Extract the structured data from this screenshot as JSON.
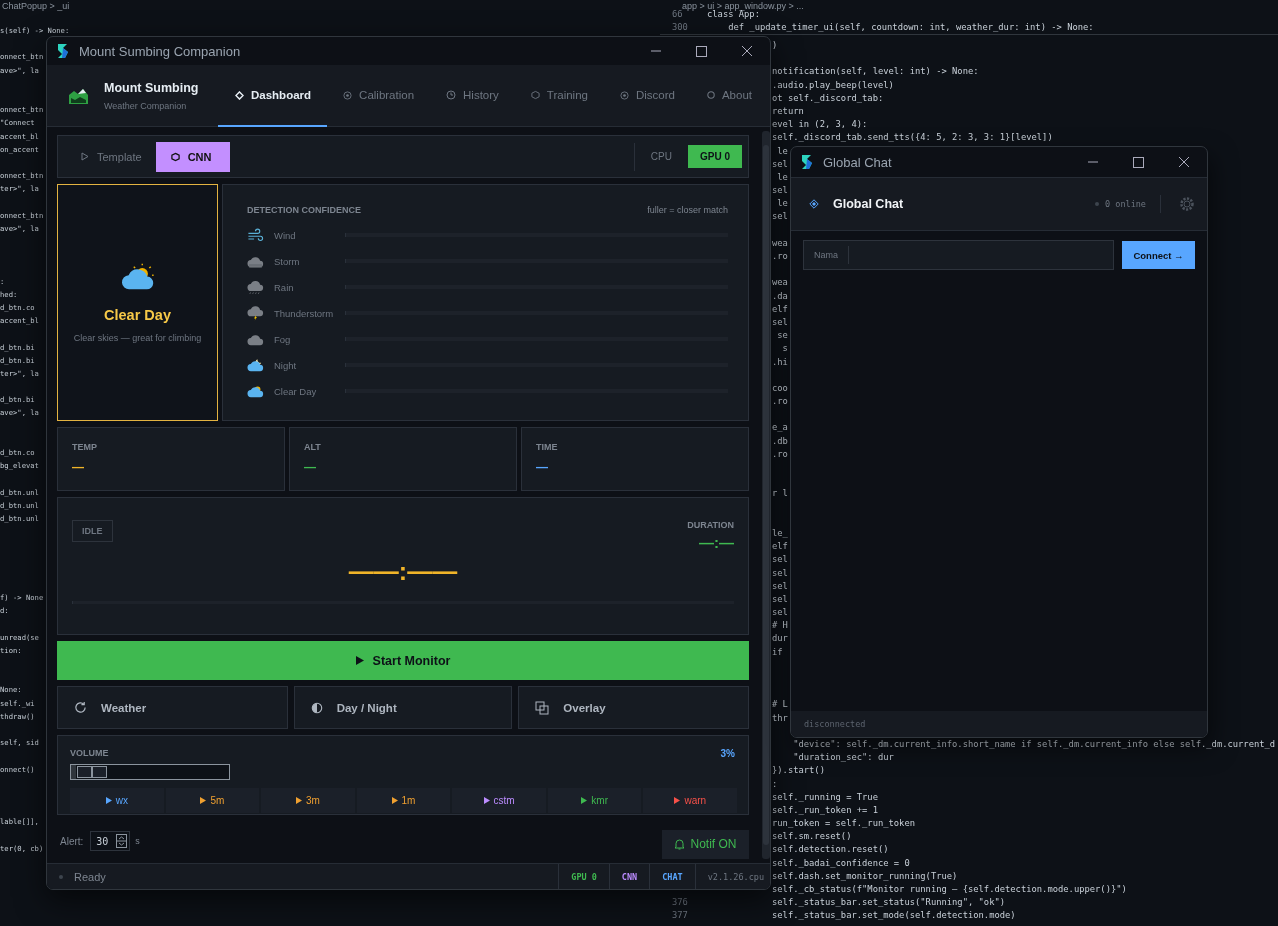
{
  "editor": {
    "left_breadcrumb": "ChatPopup > _ui",
    "left_lines": [
      {
        "kind": "code",
        "text": "s(self) -> None:"
      },
      {
        "kind": "blank"
      },
      {
        "kind": "code",
        "text": "onnect_btn"
      },
      {
        "kind": "code",
        "text": "ave>\", la"
      },
      {
        "kind": "blank"
      },
      {
        "kind": "blank"
      },
      {
        "kind": "code",
        "text": "onnect_btn"
      },
      {
        "kind": "code",
        "text": "\"Connect"
      },
      {
        "kind": "code",
        "text": "accent_bl"
      },
      {
        "kind": "code",
        "text": "on_accent"
      },
      {
        "kind": "blank"
      },
      {
        "kind": "code",
        "text": "onnect_btn"
      },
      {
        "kind": "code",
        "text": "ter>\", la"
      },
      {
        "kind": "blank"
      },
      {
        "kind": "code",
        "text": "onnect_btn"
      },
      {
        "kind": "code",
        "text": "ave>\", la"
      },
      {
        "kind": "blank"
      },
      {
        "kind": "blank"
      },
      {
        "kind": "blank"
      },
      {
        "kind": "code",
        "text": ":"
      },
      {
        "kind": "code",
        "text": "hed:"
      },
      {
        "kind": "code",
        "text": "d_btn.co"
      },
      {
        "kind": "code",
        "text": "accent_bl"
      },
      {
        "kind": "blank"
      },
      {
        "kind": "code",
        "text": "d_btn.bi"
      },
      {
        "kind": "code",
        "text": "d_btn.bi"
      },
      {
        "kind": "code",
        "text": "ter>\", la"
      },
      {
        "kind": "blank"
      },
      {
        "kind": "code",
        "text": "d_btn.bi"
      },
      {
        "kind": "code",
        "text": "ave>\", la"
      },
      {
        "kind": "blank"
      },
      {
        "kind": "blank"
      },
      {
        "kind": "code",
        "text": "d_btn.co"
      },
      {
        "kind": "code",
        "text": "bg_elevat"
      },
      {
        "kind": "blank"
      },
      {
        "kind": "code",
        "text": "d_btn.unl"
      },
      {
        "kind": "code",
        "text": "d_btn.unl"
      },
      {
        "kind": "code",
        "text": "d_btn.unl"
      },
      {
        "kind": "blank"
      },
      {
        "kind": "blank"
      },
      {
        "kind": "blank"
      },
      {
        "kind": "blank"
      },
      {
        "kind": "blank"
      },
      {
        "kind": "code",
        "text": "f) -> None"
      },
      {
        "kind": "code",
        "text": "d:"
      },
      {
        "kind": "blank"
      },
      {
        "kind": "code",
        "text": "unread(se"
      },
      {
        "kind": "code",
        "text": "tion:"
      },
      {
        "kind": "blank"
      },
      {
        "kind": "blank"
      },
      {
        "kind": "code",
        "text": "None:"
      },
      {
        "kind": "code",
        "text": "self._wi"
      },
      {
        "kind": "code",
        "text": "thdraw()"
      },
      {
        "kind": "blank"
      },
      {
        "kind": "code",
        "text": "self, sid"
      },
      {
        "kind": "blank"
      },
      {
        "kind": "code",
        "text": "onnect()"
      },
      {
        "kind": "blank"
      },
      {
        "kind": "blank"
      },
      {
        "kind": "blank"
      },
      {
        "kind": "code",
        "text": "lable[]],"
      },
      {
        "kind": "blank"
      },
      {
        "kind": "code",
        "text": "ter(0, cb)"
      }
    ],
    "right_breadcrumb": "app > ui > app_window.py > ...",
    "sticky": [
      {
        "number": "66",
        "text": "class App:"
      },
      {
        "number": "300",
        "text": "    def _update_timer_ui(self, countdown: int, weather_dur: int) -> None:"
      }
    ],
    "right_lines": [
      {
        "kind": "code",
        "text": ")"
      },
      {
        "kind": "blank"
      },
      {
        "kind": "code",
        "text": "notification(self, level: int) -> None:"
      },
      {
        "kind": "code",
        "text": ".audio.play_beep(level)"
      },
      {
        "kind": "code",
        "text": "ot self._discord_tab:"
      },
      {
        "kind": "code",
        "text": "return"
      },
      {
        "kind": "code",
        "text": "evel in (2, 3, 4):"
      },
      {
        "kind": "code",
        "text": "self._discord_tab.send_tts({4: 5, 2: 3, 3: 1}[level])"
      },
      {
        "kind": "code",
        "text": " le"
      },
      {
        "kind": "code",
        "text": "sel"
      },
      {
        "kind": "code",
        "text": " le"
      },
      {
        "kind": "code",
        "text": "sel"
      },
      {
        "kind": "code",
        "text": " le"
      },
      {
        "kind": "code",
        "text": "sel"
      },
      {
        "kind": "blank"
      },
      {
        "kind": "code",
        "text": "wea"
      },
      {
        "kind": "code",
        "text": ".ro"
      },
      {
        "kind": "blank"
      },
      {
        "kind": "code",
        "text": "wea"
      },
      {
        "kind": "code",
        "text": ".da"
      },
      {
        "kind": "code",
        "text": "elf"
      },
      {
        "kind": "code",
        "text": "sel"
      },
      {
        "kind": "code",
        "text": " se"
      },
      {
        "kind": "code",
        "text": "  s"
      },
      {
        "kind": "code",
        "text": ".hi"
      },
      {
        "kind": "blank"
      },
      {
        "kind": "code",
        "text": "coo"
      },
      {
        "kind": "code",
        "text": ".ro"
      },
      {
        "kind": "blank"
      },
      {
        "kind": "code",
        "text": "e_a"
      },
      {
        "kind": "code",
        "text": ".db"
      },
      {
        "kind": "code",
        "text": ".ro"
      },
      {
        "kind": "blank"
      },
      {
        "kind": "blank"
      },
      {
        "kind": "code",
        "text": "r l"
      },
      {
        "kind": "blank"
      },
      {
        "kind": "blank"
      },
      {
        "kind": "code",
        "text": "le_"
      },
      {
        "kind": "code",
        "text": "elf"
      },
      {
        "kind": "code",
        "text": "sel"
      },
      {
        "kind": "code",
        "text": "sel"
      },
      {
        "kind": "code",
        "text": "sel"
      },
      {
        "kind": "code",
        "text": "sel"
      },
      {
        "kind": "code",
        "text": "sel"
      },
      {
        "kind": "code",
        "text": "# H"
      },
      {
        "kind": "code",
        "text": "dur"
      },
      {
        "kind": "code",
        "text": "if"
      },
      {
        "kind": "blank"
      },
      {
        "kind": "blank"
      },
      {
        "kind": "blank"
      },
      {
        "kind": "code",
        "text": "# L"
      },
      {
        "kind": "code",
        "text": "thr"
      },
      {
        "kind": "blank"
      },
      {
        "kind": "code",
        "text": "    \"device\": self._dm.current_info.short_name if self._dm.current_info else self._dm.current_d"
      },
      {
        "kind": "code",
        "text": "    \"duration_sec\": dur"
      },
      {
        "kind": "code",
        "text": "}).start()"
      },
      {
        "kind": "code",
        "text": ":"
      },
      {
        "kind": "code",
        "text": "self._running = True"
      },
      {
        "kind": "code",
        "text": "self._run_token += 1"
      },
      {
        "kind": "code",
        "text": "run_token = self._run_token"
      },
      {
        "kind": "code",
        "text": "self.sm.reset()"
      },
      {
        "kind": "code",
        "text": "self.detection.reset()"
      },
      {
        "kind": "code",
        "text": "self._badai_confidence = 0"
      },
      {
        "kind": "code",
        "text": "self.dash.set_monitor_running(True)"
      },
      {
        "kind": "code",
        "text": "self._cb_status(f\"Monitor running — {self.detection.mode.upper()}\")"
      },
      {
        "kind": "code",
        "number": "376",
        "text": "self._status_bar.set_status(\"Running\", \"ok\")"
      },
      {
        "kind": "code",
        "number": "377",
        "text": "self._status_bar.set_mode(self.detection.mode)"
      }
    ]
  },
  "main_window": {
    "title": "Mount Sumbing Companion",
    "brand": {
      "name": "Mount Sumbing",
      "subtitle": "Weather Companion"
    },
    "tabs": [
      {
        "label": "Dashboard",
        "selected": true
      },
      {
        "label": "Calibration",
        "selected": false
      },
      {
        "label": "History",
        "selected": false
      },
      {
        "label": "Training",
        "selected": false
      },
      {
        "label": "Discord",
        "selected": false
      },
      {
        "label": "About",
        "selected": false
      }
    ],
    "modes": [
      {
        "label": "Template",
        "selected": false
      },
      {
        "label": "CNN",
        "selected": true
      }
    ],
    "devices": [
      {
        "label": "CPU",
        "selected": false
      },
      {
        "label": "GPU 0",
        "selected": true
      }
    ],
    "current": {
      "label": "Clear Day",
      "description": "Clear skies — great for climbing"
    },
    "detection": {
      "title": "DETECTION CONFIDENCE",
      "hint": "fuller = closer match",
      "rows": [
        {
          "label": "Wind",
          "level": 0
        },
        {
          "label": "Storm",
          "level": 0
        },
        {
          "label": "Rain",
          "level": 0
        },
        {
          "label": "Thunderstorm",
          "level": 0
        },
        {
          "label": "Fog",
          "level": 0
        },
        {
          "label": "Night",
          "level": 0
        },
        {
          "label": "Clear Day",
          "level": 0
        }
      ]
    },
    "stats": [
      {
        "label": "TEMP",
        "value": "—",
        "color": "#f0b429"
      },
      {
        "label": "ALT",
        "value": "—",
        "color": "#3fb950"
      },
      {
        "label": "TIME",
        "value": "—",
        "color": "#58a6ff"
      }
    ],
    "timer": {
      "state": "IDLE",
      "duration_label": "DURATION",
      "duration": "—:—",
      "countdown": "——:——",
      "level": 0
    },
    "start_button": "Start Monitor",
    "actions": [
      {
        "label": "Weather"
      },
      {
        "label": "Day / Night"
      },
      {
        "label": "Overlay"
      }
    ],
    "volume": {
      "label": "VOLUME",
      "reading": "3%",
      "level": 0.03,
      "sounds": [
        {
          "label": "wx",
          "color": "#58a6ff"
        },
        {
          "label": "5m",
          "color": "#f0a030"
        },
        {
          "label": "3m",
          "color": "#f0a030"
        },
        {
          "label": "1m",
          "color": "#f0a030"
        },
        {
          "label": "cstm",
          "color": "#bc8cff"
        },
        {
          "label": "kmr",
          "color": "#3fb950"
        },
        {
          "label": "warn",
          "color": "#f85149"
        }
      ]
    },
    "alert": {
      "label": "Alert:",
      "value": "30",
      "unit": "s"
    },
    "notif_button": "Notif ON",
    "status_bar": {
      "status": "Ready",
      "badges": [
        {
          "label": "GPU 0",
          "color": "#3fb950"
        },
        {
          "label": "CNN",
          "color": "#bc8cff"
        },
        {
          "label": "CHAT",
          "color": "#58a6ff"
        }
      ],
      "version": "v2.1.26.cpu"
    }
  },
  "chat_window": {
    "title": "Global Chat",
    "heading": "Global Chat",
    "online": "0 online",
    "name_label": "Nama",
    "connect_button": "Connect →",
    "footer": "disconnected"
  }
}
